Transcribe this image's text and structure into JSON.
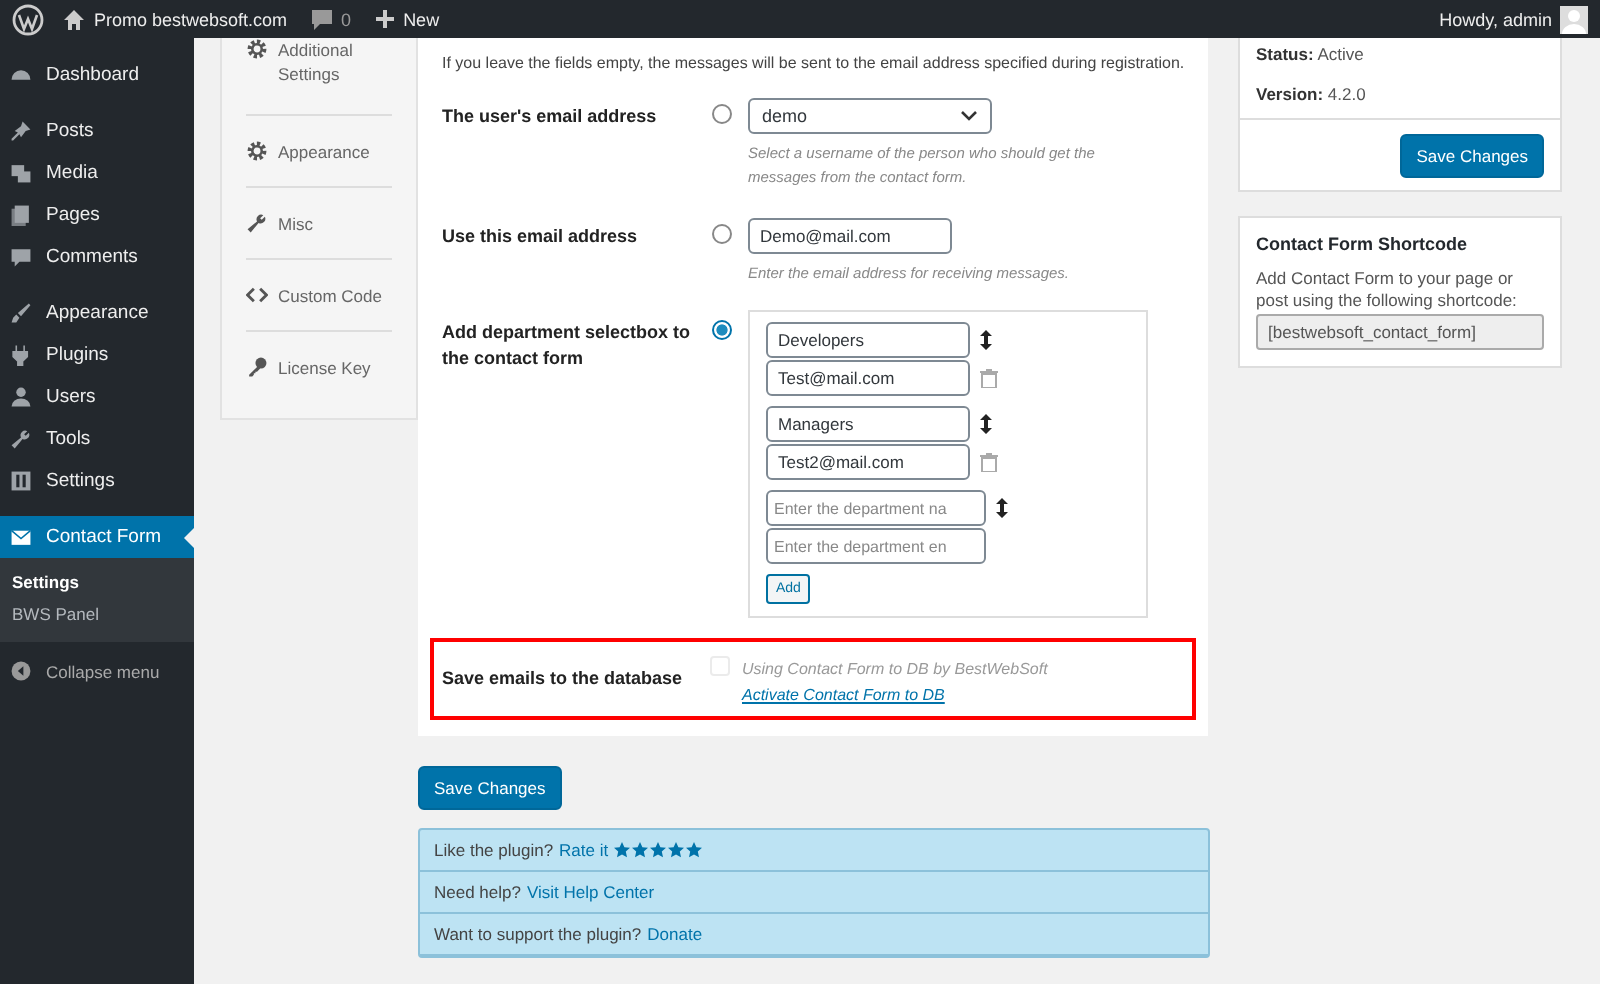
{
  "admin_bar": {
    "site": "Promo bestwebsoft.com",
    "comments": "0",
    "new": "New",
    "greeting": "Howdy, admin"
  },
  "sidebar": {
    "groups": [
      [
        {
          "label": "Dashboard",
          "selected": false
        }
      ],
      [
        {
          "label": "Posts",
          "selected": false
        },
        {
          "label": "Media",
          "selected": false
        },
        {
          "label": "Pages",
          "selected": false
        },
        {
          "label": "Comments",
          "selected": false
        }
      ],
      [
        {
          "label": "Appearance",
          "selected": false
        },
        {
          "label": "Plugins",
          "selected": false
        },
        {
          "label": "Users",
          "selected": false
        },
        {
          "label": "Tools",
          "selected": false
        },
        {
          "label": "Settings",
          "selected": false
        }
      ],
      [
        {
          "label": "Contact Form",
          "selected": true,
          "children": [
            {
              "label": "Settings",
              "selected": true
            },
            {
              "label": "BWS Panel",
              "selected": false
            }
          ]
        }
      ]
    ],
    "collapse": "Collapse menu"
  },
  "plugin_tabs": [
    {
      "label": "Additional Settings",
      "selected": false
    },
    {
      "label": "Appearance",
      "selected": false
    },
    {
      "label": "Misc",
      "selected": false
    },
    {
      "label": "Custom Code",
      "selected": false
    },
    {
      "label": "License Key",
      "selected": false
    }
  ],
  "form": {
    "intro": "If you leave the fields empty, the messages will be sent to the email address specified during registration.",
    "rows": [
      {
        "kind": "select",
        "label": "The user's email address",
        "selected": false,
        "value": "demo",
        "hint": "Select a username of the person who should get the messages from the contact form."
      },
      {
        "kind": "text",
        "label": "Use this email address",
        "selected": false,
        "value": "Demo@mail.com",
        "hint": "Enter the email address for receiving messages."
      },
      {
        "kind": "departments",
        "label": "Add department selectbox to the contact form",
        "selected": true,
        "departments": [
          {
            "name": "Developers",
            "email": "Test@mail.com"
          },
          {
            "name": "Managers",
            "email": "Test2@mail.com"
          }
        ],
        "new_department": {
          "name_placeholder": "Enter the department na",
          "email_placeholder": "Enter the department en"
        },
        "add_button": "Add"
      },
      {
        "kind": "checkbox",
        "label": "Save emails to the database",
        "highlighted": true,
        "checked": false,
        "disabled": true,
        "text": "Using Contact Form to DB by BestWebSoft",
        "link": "Activate Contact Form to DB"
      }
    ]
  },
  "save_button": "Save Changes",
  "notices": [
    {
      "text": "Like the plugin?",
      "link": "Rate it",
      "stars": 5
    },
    {
      "text": "Need help?",
      "link": "Visit Help Center"
    },
    {
      "text": "Want to support the plugin?",
      "link": "Donate"
    }
  ],
  "status_panel": {
    "status": "**Status:** Active",
    "version": "**Version:** 4.2.0",
    "button": "Save Changes"
  },
  "shortcode_panel": {
    "title": "Contact Form Shortcode",
    "text": "Add Contact Form to your page or post using the following shortcode:",
    "shortcode": "[bestwebsoft_contact_form]"
  }
}
